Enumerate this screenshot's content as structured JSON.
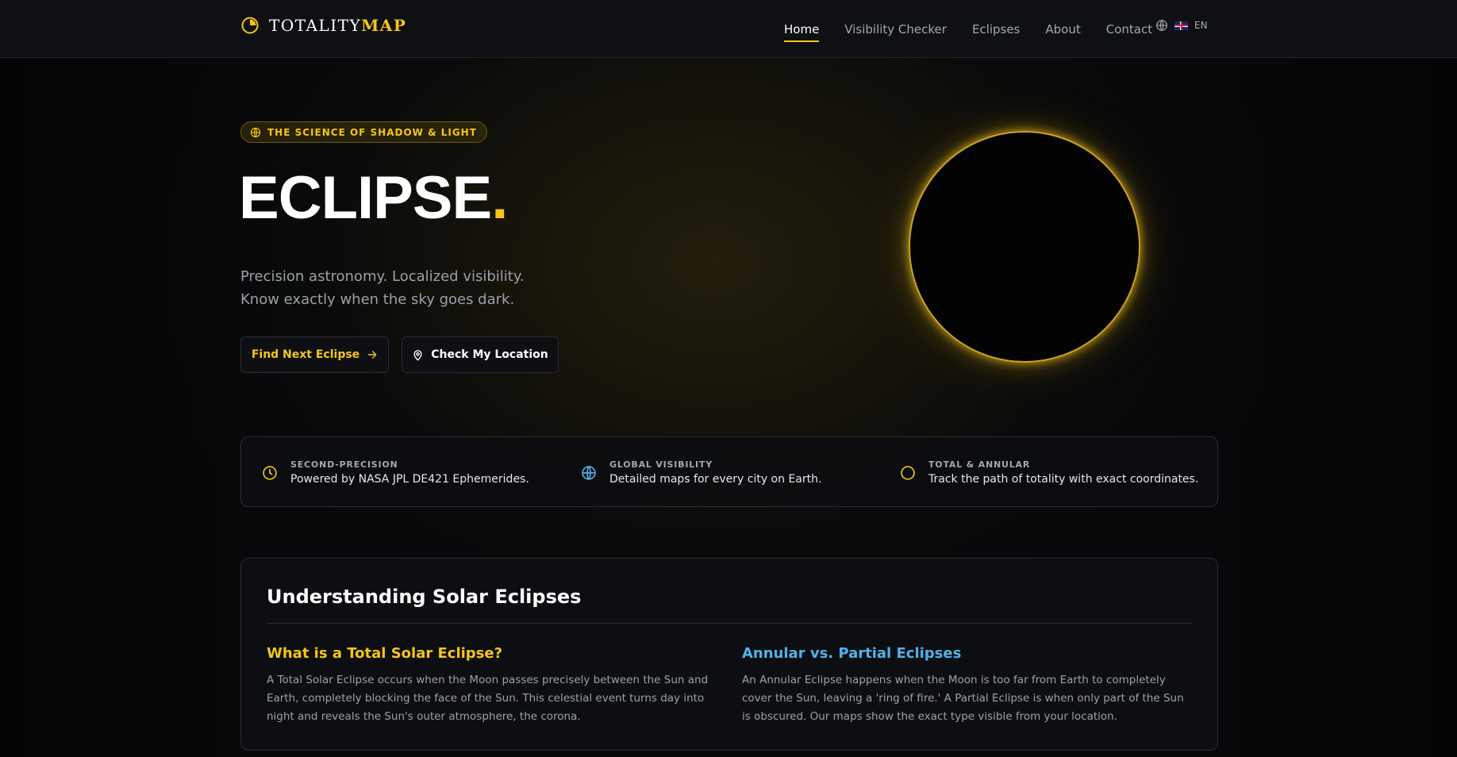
{
  "brand": {
    "name_main": "TOTALITY",
    "name_accent": "MAP",
    "accent_color": "#f5c518"
  },
  "nav": {
    "items": [
      {
        "label": "Home",
        "active": true
      },
      {
        "label": "Visibility Checker",
        "active": false
      },
      {
        "label": "Eclipses",
        "active": false
      },
      {
        "label": "About",
        "active": false
      },
      {
        "label": "Contact",
        "active": false
      }
    ],
    "language": {
      "code": "EN",
      "icon": "globe-icon",
      "flag": "uk-flag"
    }
  },
  "hero": {
    "badge": "THE SCIENCE OF SHADOW & LIGHT",
    "title": "ECLIPSE",
    "title_dot": ".",
    "subtitle_line1": "Precision astronomy. Localized visibility.",
    "subtitle_line2": "Know exactly when the sky goes dark.",
    "primary_button": "Find Next Eclipse",
    "secondary_button": "Check My Location"
  },
  "features": [
    {
      "icon": "clock-icon",
      "label": "SECOND-PRECISION",
      "text": "Powered by NASA JPL DE421 Ephemerides.",
      "color": "#f5c518"
    },
    {
      "icon": "globe-icon",
      "label": "GLOBAL VISIBILITY",
      "text": "Detailed maps for every city on Earth.",
      "color": "#4fb3e8"
    },
    {
      "icon": "circle-icon",
      "label": "TOTAL & ANNULAR",
      "text": "Track the path of totality with exact coordinates.",
      "color": "#f5c518"
    }
  ],
  "understanding": {
    "title": "Understanding Solar Eclipses",
    "left": {
      "heading": "What is a Total Solar Eclipse?",
      "body": "A Total Solar Eclipse occurs when the Moon passes precisely between the Sun and Earth, completely blocking the face of the Sun. This celestial event turns day into night and reveals the Sun's outer atmosphere, the corona."
    },
    "right": {
      "heading": "Annular vs. Partial Eclipses",
      "body": "An Annular Eclipse happens when the Moon is too far from Earth to completely cover the Sun, leaving a 'ring of fire.' A Partial Eclipse is when only part of the Sun is obscured. Our maps show the exact type visible from your location."
    }
  }
}
